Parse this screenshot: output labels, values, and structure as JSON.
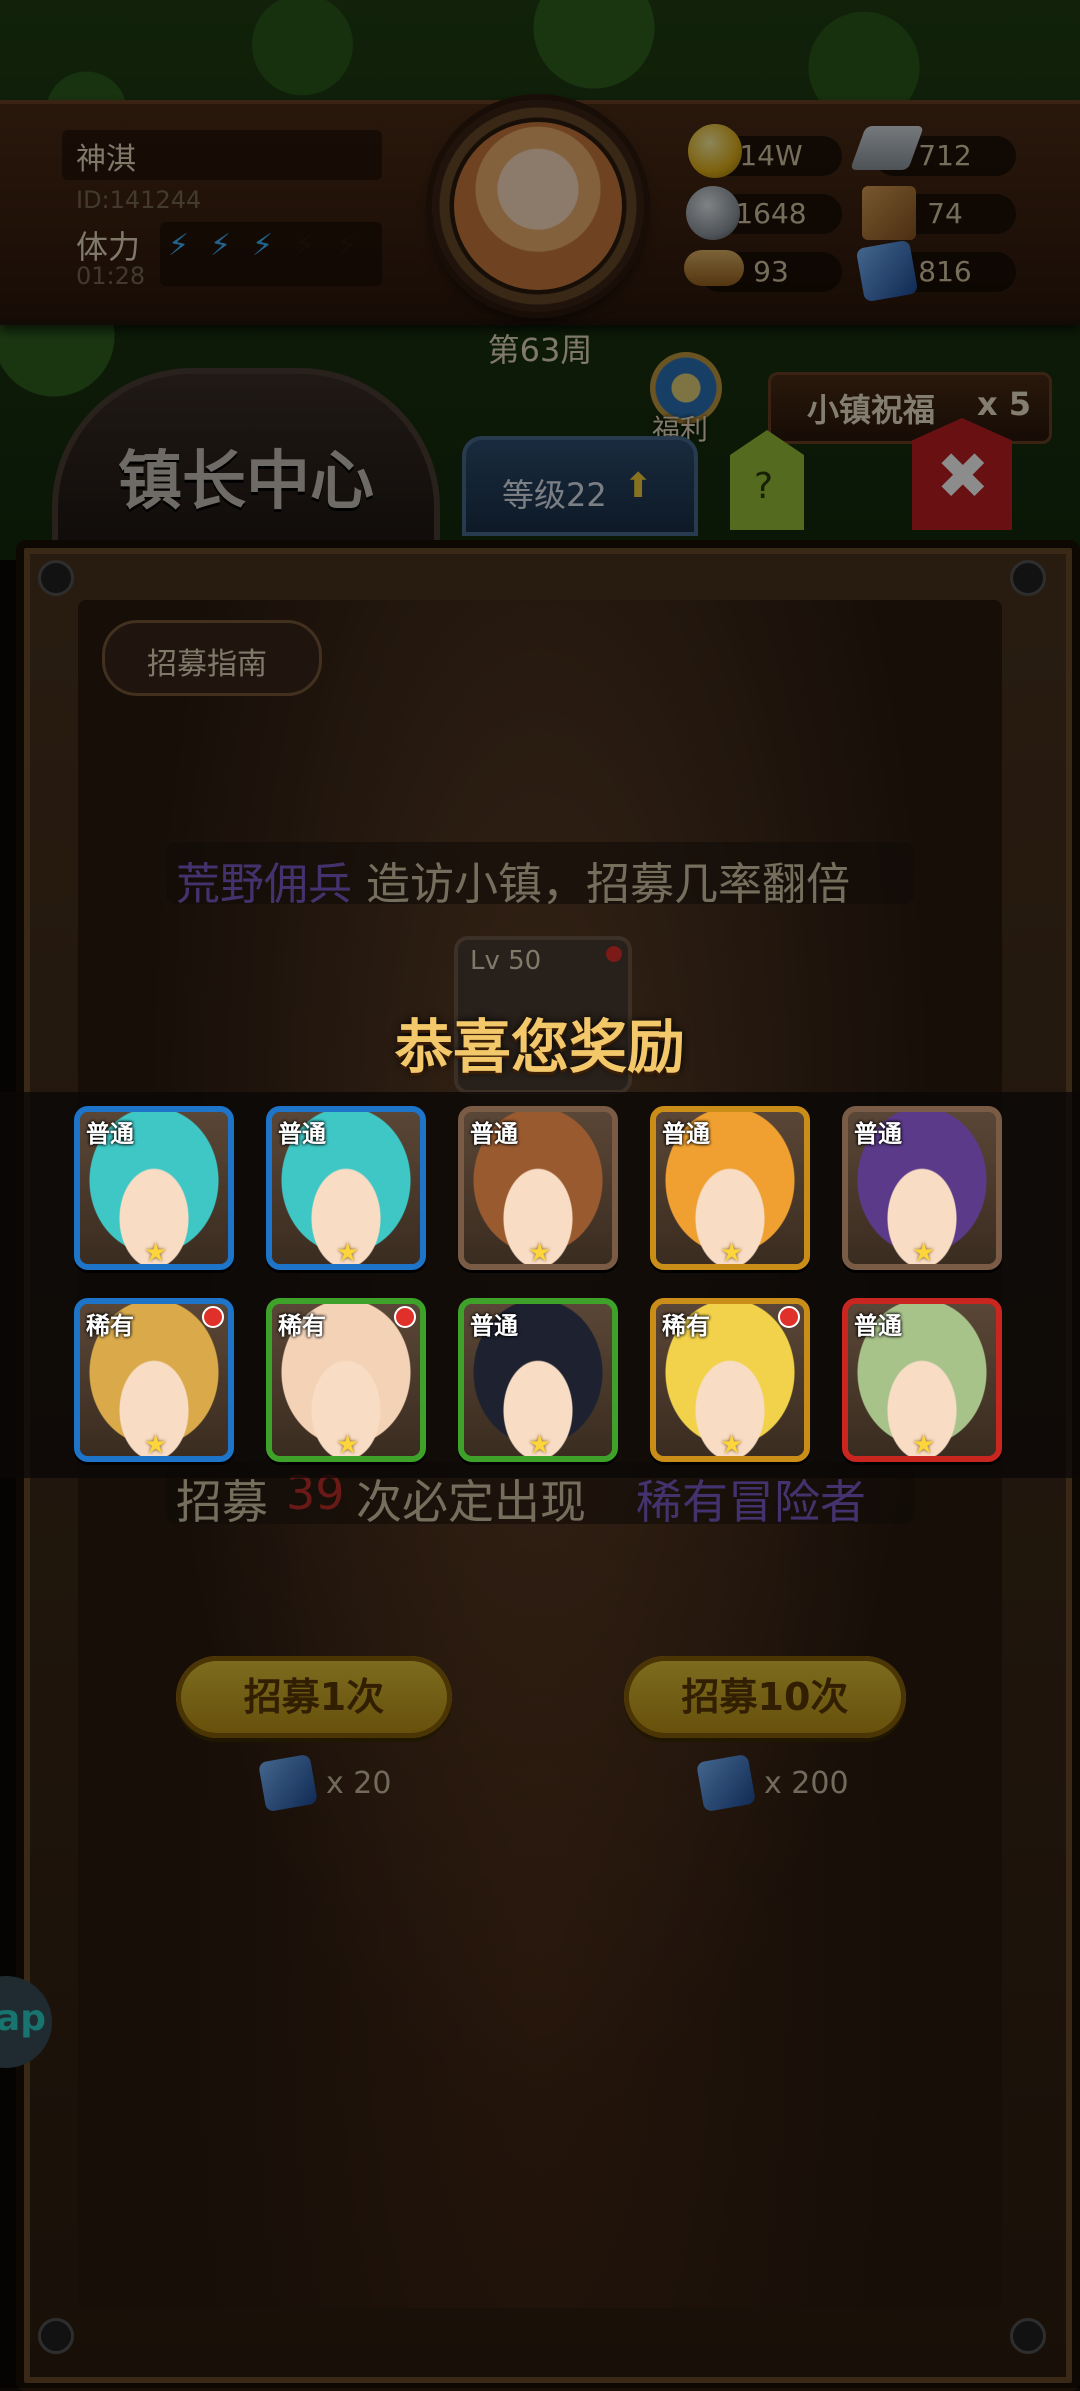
{
  "player": {
    "name": "神淇",
    "id": "ID:141244",
    "stamina_label": "体力",
    "stamina_timer": "01:28",
    "stamina_filled": 3,
    "stamina_total": 5,
    "week": "第63周"
  },
  "resources": {
    "gold": "14W",
    "iron": "712",
    "ore": "1648",
    "leather": "74",
    "wood": "93",
    "crystal": "816"
  },
  "nav": {
    "welfare": "福利",
    "town_blessing": "小镇祝福",
    "town_blessing_count": "x 5",
    "center_title": "镇长中心",
    "level": "等级22",
    "help": "?"
  },
  "recruit": {
    "guide": "招募指南",
    "event_highlight": "荒野佣兵",
    "event_text": "造访小镇，招募几率翻倍",
    "level_badge": "Lv 50",
    "pity_prefix": "招募",
    "pity_count": "39",
    "pity_mid": "次必定出现",
    "pity_rarity": "稀有冒险者",
    "once_label": "招募1次",
    "once_cost": "x 20",
    "ten_label": "招募10次",
    "ten_cost": "x 200"
  },
  "reward": {
    "title": "恭喜您奖励",
    "cards": [
      {
        "tag": "普通",
        "frame": "#1d74c8",
        "hair": "#3fc7c6",
        "new": false
      },
      {
        "tag": "普通",
        "frame": "#1d74c8",
        "hair": "#3fc7c6",
        "new": false
      },
      {
        "tag": "普通",
        "frame": "#7a5b45",
        "hair": "#9a5a30",
        "new": false
      },
      {
        "tag": "普通",
        "frame": "#c98d18",
        "hair": "#f0a030",
        "new": false
      },
      {
        "tag": "普通",
        "frame": "#7a5b45",
        "hair": "#5b3a8a",
        "new": false
      },
      {
        "tag": "稀有",
        "frame": "#1d74c8",
        "hair": "#d9a94a",
        "new": true
      },
      {
        "tag": "稀有",
        "frame": "#3ea22a",
        "hair": "#f3d2b6",
        "new": true
      },
      {
        "tag": "普通",
        "frame": "#3ea22a",
        "hair": "#1e2230",
        "new": false
      },
      {
        "tag": "稀有",
        "frame": "#c98d18",
        "hair": "#f2d24a",
        "new": true
      },
      {
        "tag": "普通",
        "frame": "#c8261f",
        "hair": "#a8c38a",
        "new": false
      }
    ]
  },
  "side_button": "ap",
  "colors": {
    "accent_purple": "#7a5cc8",
    "pity_red": "#c0302a",
    "title_gold": "#f2c86a"
  }
}
